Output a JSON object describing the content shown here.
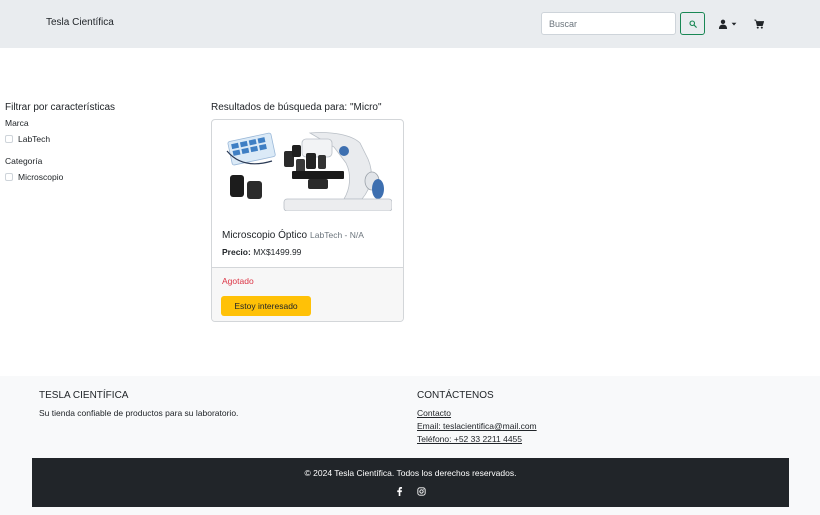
{
  "navbar": {
    "brand": "Tesla Científica",
    "search_placeholder": "Buscar",
    "icons": [
      "search-icon",
      "user-icon",
      "caret-down-icon",
      "cart-icon"
    ]
  },
  "filters": {
    "title": "Filtrar por características",
    "groups": [
      {
        "title": "Marca",
        "options": [
          "LabTech"
        ]
      },
      {
        "title": "Categoría",
        "options": [
          "Microscopio"
        ]
      }
    ]
  },
  "results": {
    "title": "Resultados de búsqueda para: \"Micro\"",
    "products": [
      {
        "name": "Microscopio Óptico",
        "brand_info": "LabTech - N/A",
        "price_label": "Precio:",
        "price": "MX$1499.99",
        "stock_status": "Agotado",
        "button_label": "Estoy interesado"
      }
    ]
  },
  "footer": {
    "about_title": "TESLA CIENTÍFICA",
    "about_text": "Su tienda confiable de productos para su laboratorio.",
    "contact_title": "CONTÁCTENOS",
    "contact_link": "Contacto",
    "email": "Email: teslacientifica@mail.com",
    "phone": "Teléfono: +52 33 2211 4455",
    "copyright": "© 2024 Tesla Científica. Todos los derechos reservados.",
    "social_icons": [
      "facebook-icon",
      "instagram-icon"
    ]
  },
  "colors": {
    "navbar_bg": "#e9ecef",
    "accent_green": "#198754",
    "warning_yellow": "#ffc107",
    "danger_red": "#dc3545",
    "dark_footer": "#212529"
  }
}
